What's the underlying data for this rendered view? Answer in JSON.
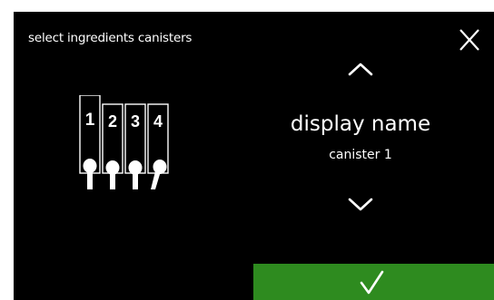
{
  "header": {
    "title": "select ingredients canisters",
    "close_icon": "close-icon"
  },
  "canisters": {
    "labels": [
      "1",
      "2",
      "3",
      "4"
    ],
    "selected_index": 0
  },
  "selector": {
    "up_icon": "chevron-up-icon",
    "label": "display name",
    "value": "canister 1",
    "down_icon": "chevron-down-icon"
  },
  "footer": {
    "confirm_icon": "checkmark-icon"
  },
  "colors": {
    "background": "#000000",
    "foreground": "#ffffff",
    "confirm": "#2e8b1f"
  }
}
